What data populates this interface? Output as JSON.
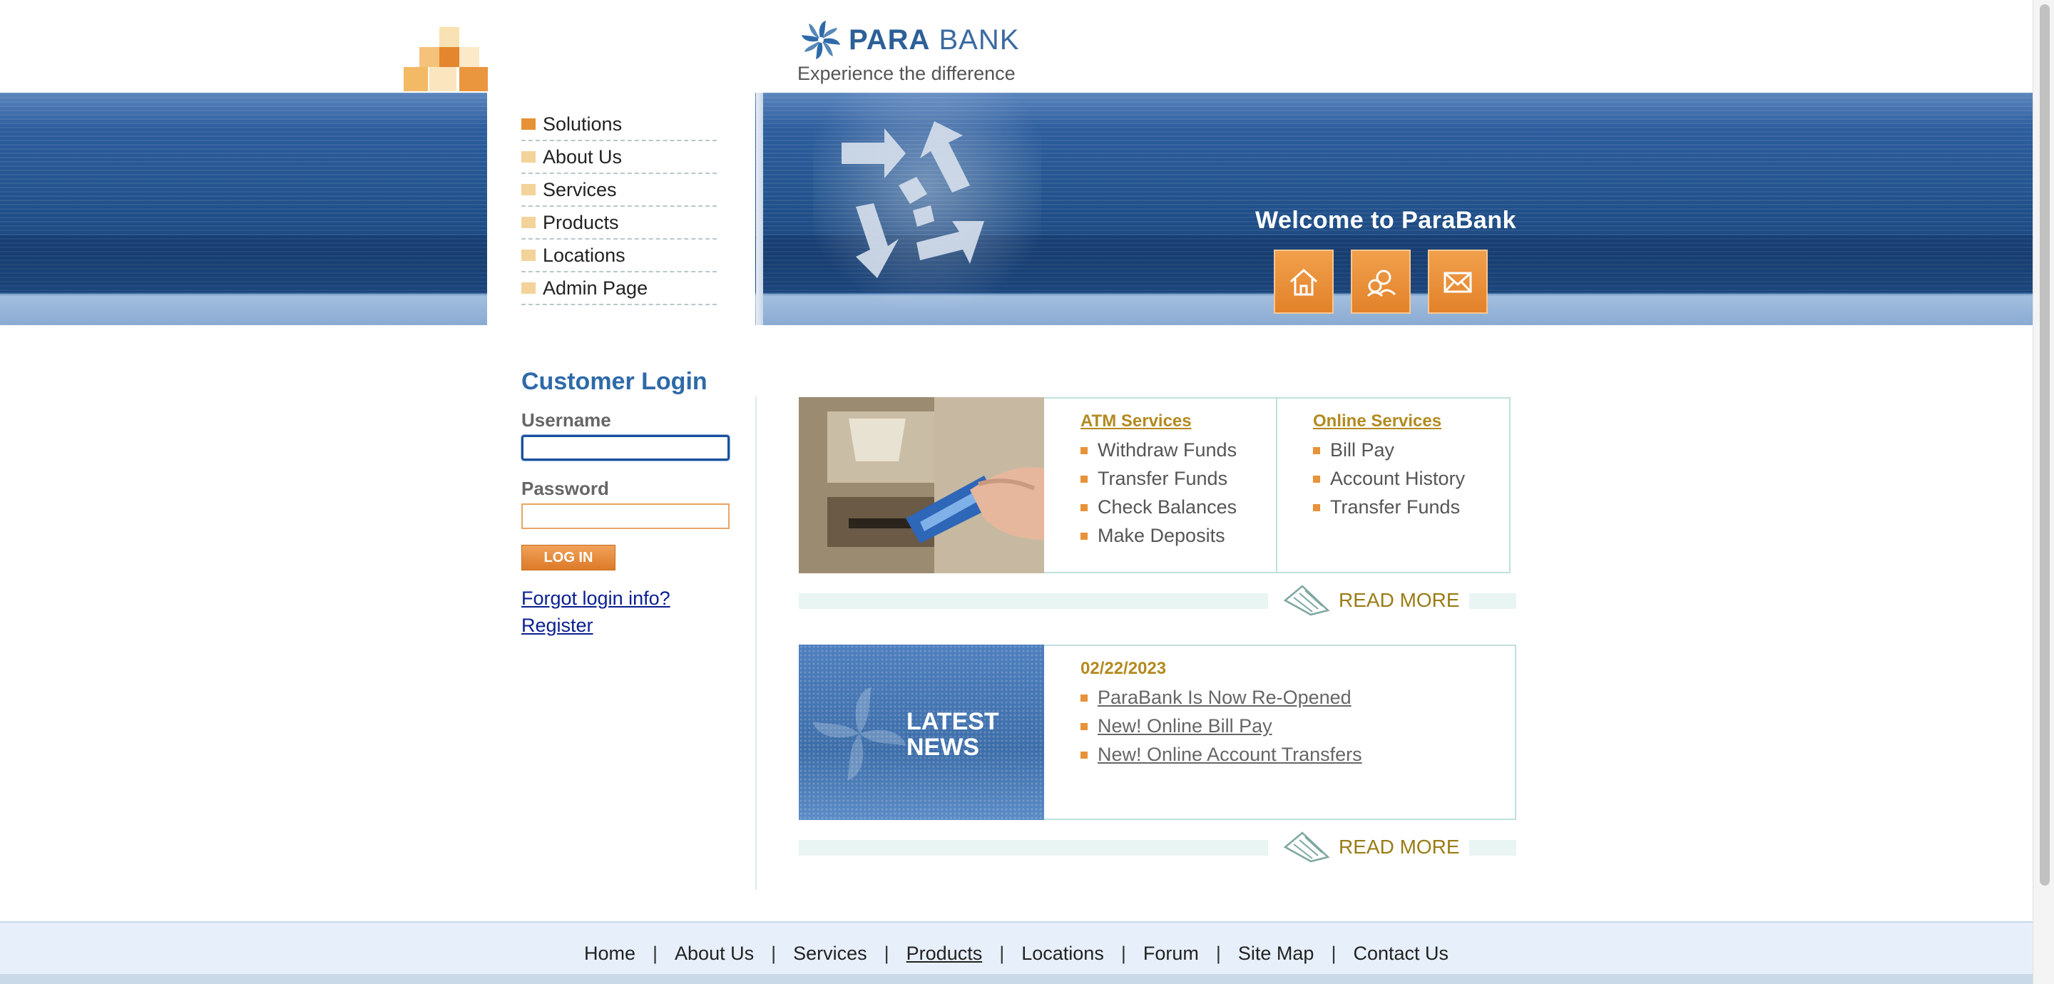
{
  "colors": {
    "brand_blue": "#2e6aa8",
    "accent_orange": "#e59136",
    "link_gold": "#b38a1f",
    "footer_bg": "#e7f0fa"
  },
  "header": {
    "brand_bold": "PARA",
    "brand_light": "BANK",
    "tagline": "Experience the difference",
    "welcome": "Welcome to ParaBank",
    "buttons": [
      {
        "icon": "home-icon"
      },
      {
        "icon": "about-people-icon"
      },
      {
        "icon": "envelope-icon"
      }
    ]
  },
  "nav": {
    "items": [
      {
        "label": "Solutions"
      },
      {
        "label": "About Us"
      },
      {
        "label": "Services"
      },
      {
        "label": "Products"
      },
      {
        "label": "Locations"
      },
      {
        "label": "Admin Page"
      }
    ]
  },
  "login": {
    "title": "Customer Login",
    "username_label": "Username",
    "username_value": "",
    "password_label": "Password",
    "password_value": "",
    "button_label": "LOG IN",
    "forgot_link": "Forgot login info?",
    "register_link": "Register"
  },
  "services": {
    "atm": {
      "heading": "ATM Services",
      "items": [
        "Withdraw Funds",
        "Transfer Funds",
        "Check Balances",
        "Make Deposits"
      ]
    },
    "online": {
      "heading": "Online Services",
      "items": [
        "Bill Pay",
        "Account History",
        "Transfer Funds"
      ]
    },
    "read_more": "READ MORE"
  },
  "news": {
    "label_line1": "LATEST",
    "label_line2": "NEWS",
    "date": "02/22/2023",
    "items": [
      "ParaBank Is Now Re-Opened",
      "New! Online Bill Pay",
      "New! Online Account Transfers"
    ],
    "read_more": "READ MORE"
  },
  "footer": {
    "links": [
      "Home",
      "About Us",
      "Services",
      "Products",
      "Locations",
      "Forum",
      "Site Map",
      "Contact Us"
    ],
    "separator": "|"
  }
}
